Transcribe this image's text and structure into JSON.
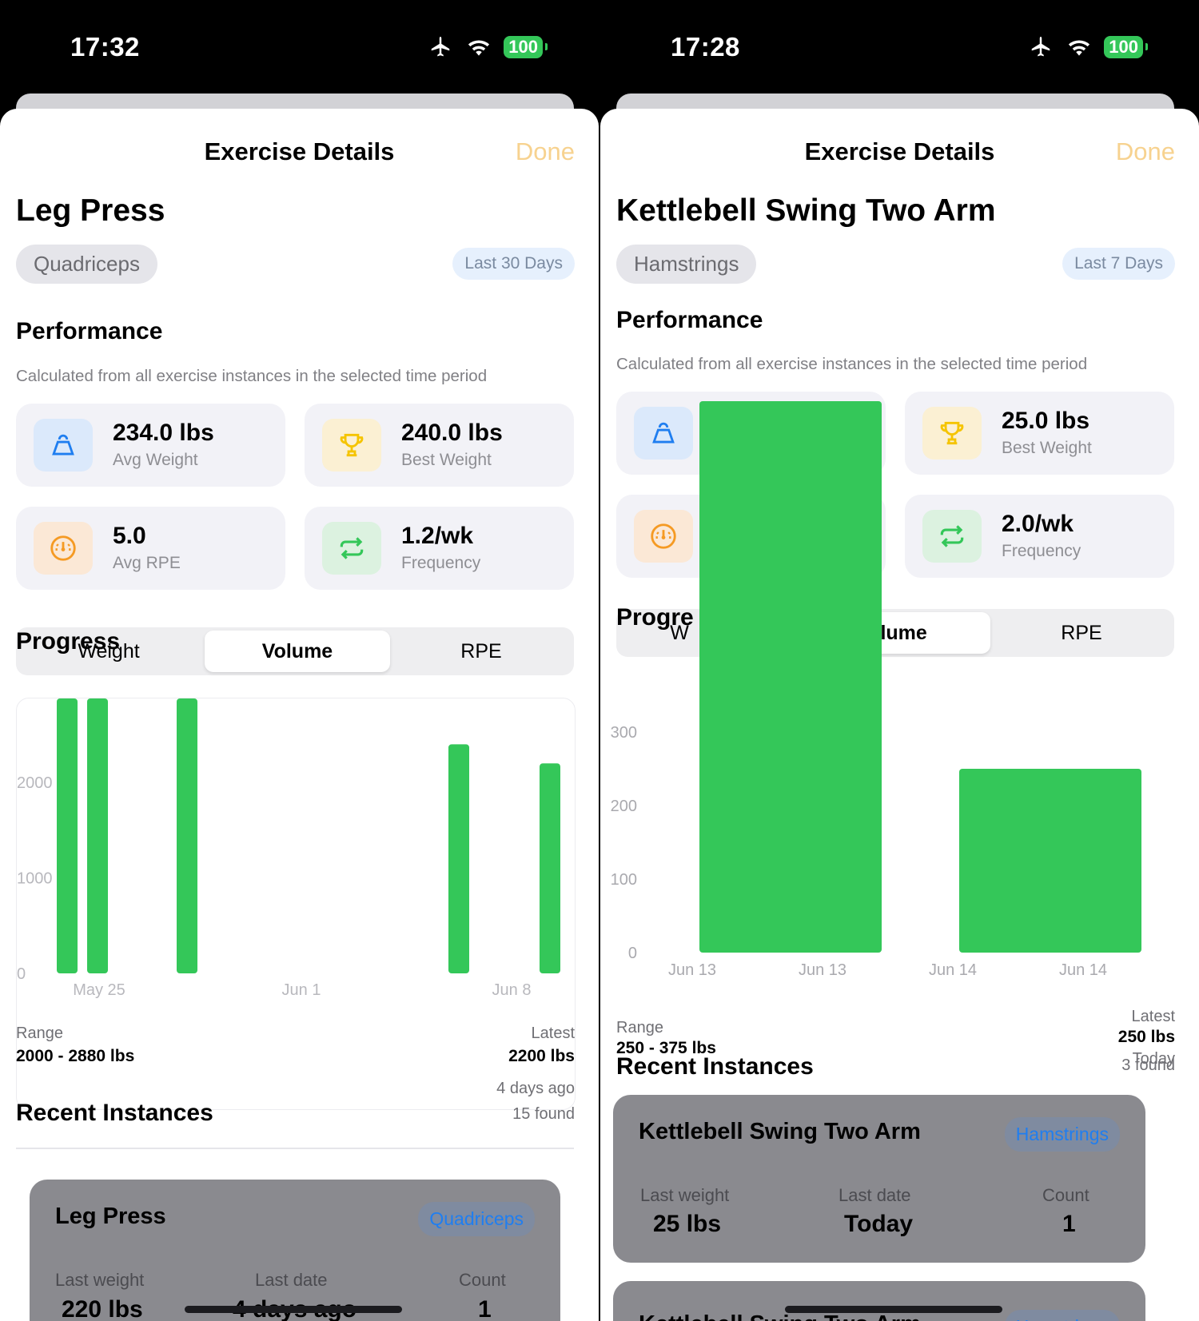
{
  "left": {
    "status": {
      "time": "17:32",
      "battery": "100"
    },
    "nav": {
      "title": "Exercise Details",
      "done": "Done"
    },
    "exercise": {
      "name": "Leg Press",
      "muscle": "Quadriceps",
      "range": "Last 30 Days"
    },
    "performance": {
      "title": "Performance",
      "caption": "Calculated from all exercise instances in the selected time period",
      "cards": [
        {
          "value": "234.0 lbs",
          "label": "Avg Weight",
          "icon": "kettlebell-icon",
          "color": "#1f7ef0"
        },
        {
          "value": "240.0 lbs",
          "label": "Best Weight",
          "icon": "trophy-icon",
          "color": "#f5c400"
        },
        {
          "value": "5.0",
          "label": "Avg RPE",
          "icon": "gauge-icon",
          "color": "#f59a23"
        },
        {
          "value": "1.2/wk",
          "label": "Frequency",
          "icon": "repeat-icon",
          "color": "#34c759"
        }
      ]
    },
    "progress": {
      "title": "Progress",
      "segments": [
        "Weight",
        "Volume",
        "RPE"
      ],
      "selected": "Volume"
    },
    "chart_data": {
      "type": "bar",
      "y_ticks": [
        "2000",
        "1000",
        "0"
      ],
      "x_ticks": [
        "May 25",
        "Jun 1",
        "Jun 8"
      ],
      "ylim": [
        0,
        2880
      ],
      "color": "#34c759",
      "series": [
        {
          "values": [
            2880,
            2880,
            2880,
            2400,
            2200
          ]
        }
      ]
    },
    "stats": {
      "range_label": "Range",
      "range_value": "2000 - 2880 lbs",
      "latest_label": "Latest",
      "latest_value": "2200 lbs",
      "latest_when": "4 days ago",
      "found": "15 found"
    },
    "recent": {
      "title": "Recent Instances",
      "items": [
        {
          "name": "Leg Press",
          "tag": "Quadriceps",
          "last_weight_label": "Last weight",
          "last_weight": "220 lbs",
          "last_date_label": "Last date",
          "last_date": "4 days ago",
          "count_label": "Count",
          "count": "1"
        }
      ]
    }
  },
  "right": {
    "status": {
      "time": "17:28",
      "battery": "100"
    },
    "nav": {
      "title": "Exercise Details",
      "done": "Done"
    },
    "exercise": {
      "name": "Kettlebell Swing Two Arm",
      "muscle": "Hamstrings",
      "range": "Last 7 Days"
    },
    "performance": {
      "title": "Performance",
      "caption": "Calculated from all exercise instances in the selected time period",
      "cards": [
        {
          "value": "25.0 lbs",
          "label": "Best Weight",
          "icon": "trophy-icon",
          "color": "#f5c400"
        },
        {
          "value": "2.0/wk",
          "label": "Frequency",
          "icon": "repeat-icon",
          "color": "#34c759"
        }
      ]
    },
    "progress": {
      "title": "Progre",
      "segments": [
        "W",
        "olume",
        "RPE"
      ],
      "selected": "Volume"
    },
    "chart_data": {
      "type": "bar",
      "y_ticks": [
        "300",
        "200",
        "100",
        "0"
      ],
      "x_ticks": [
        "Jun 13",
        "Jun 13",
        "Jun 14",
        "Jun 14"
      ],
      "ylim": [
        0,
        300
      ],
      "color": "#34c759",
      "series": [
        {
          "values": [
            750,
            250
          ]
        }
      ]
    },
    "stats": {
      "range_label": "Range",
      "range_value": "250 - 375 lbs",
      "latest_label": "Latest",
      "latest_value": "250 lbs",
      "latest_when": "Today",
      "found": "3 found"
    },
    "recent": {
      "title": "Recent Instances",
      "items": [
        {
          "name": "Kettlebell Swing Two Arm",
          "tag": "Hamstrings",
          "last_weight_label": "Last weight",
          "last_weight": "25 lbs",
          "last_date_label": "Last date",
          "last_date": "Today",
          "count_label": "Count",
          "count": "1"
        },
        {
          "name": "Kettlebell Swing Two Arm",
          "tag": "Hamstrings"
        }
      ]
    }
  }
}
